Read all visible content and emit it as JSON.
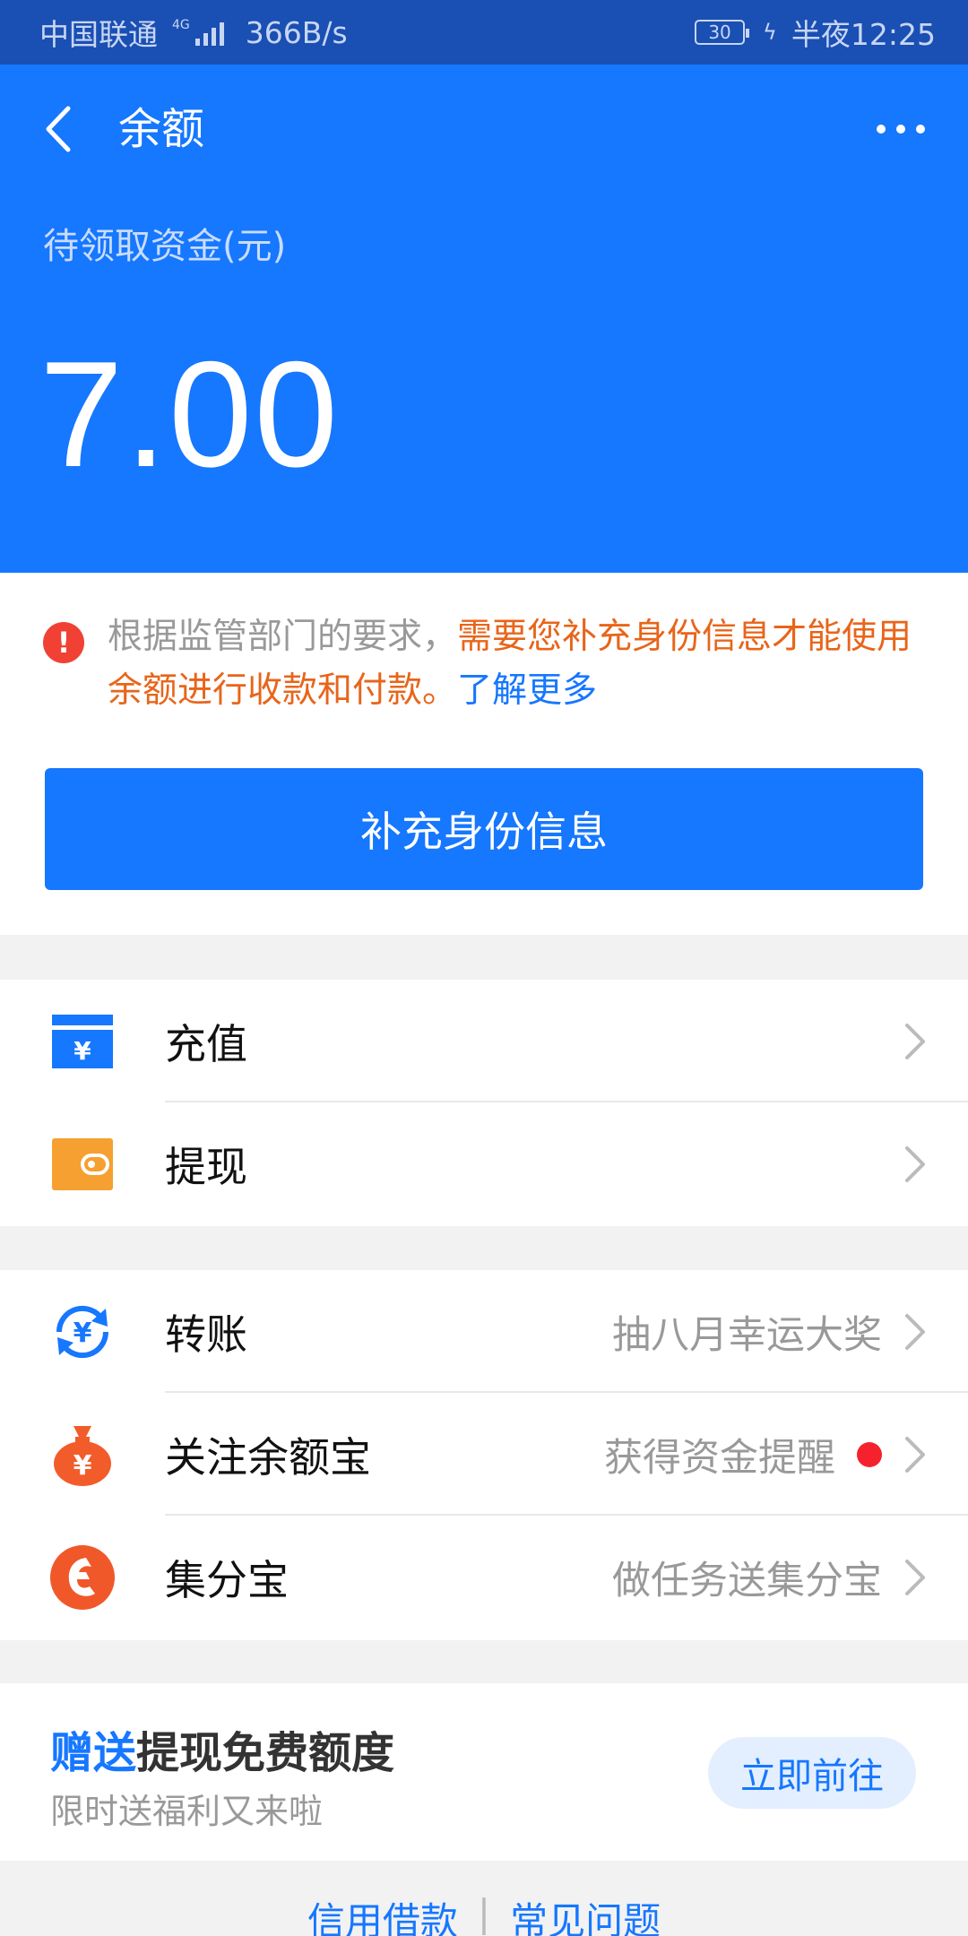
{
  "status_bar": {
    "carrier": "中国联通",
    "network": "4G",
    "speed": "366B/s",
    "battery": "30",
    "time": "半夜12:25"
  },
  "header": {
    "back_icon": "chevron-left-icon",
    "title": "余额",
    "more_icon": "more-dots-icon",
    "balance_label": "待领取资金(元)",
    "balance_amount": "7.00"
  },
  "notice": {
    "text_normal": "根据监管部门的要求，",
    "text_highlight": "需要您补充身份信息才能使用余额进行收款和付款。",
    "link": "了解更多",
    "button": "补充身份信息"
  },
  "group1": [
    {
      "icon": "recharge-icon",
      "label": "充值"
    },
    {
      "icon": "withdraw-wallet-icon",
      "label": "提现"
    }
  ],
  "group2": [
    {
      "icon": "transfer-icon",
      "label": "转账",
      "extra": "抽八月幸运大奖"
    },
    {
      "icon": "money-bag-icon",
      "label": "关注余额宝",
      "extra": "获得资金提醒"
    },
    {
      "icon": "jifenbao-icon",
      "label": "集分宝",
      "extra": "做任务送集分宝"
    }
  ],
  "promo": {
    "title_accent": "赠送",
    "title_rest": "提现免费额度",
    "subtitle": "限时送福利又来啦",
    "button": "立即前往"
  },
  "footer": {
    "link1": "信用借款",
    "separator": "|",
    "link2": "常见问题"
  },
  "colors": {
    "brand_blue": "#1677ff",
    "status_bar": "#1a4fb3",
    "warning_orange": "#e8651a",
    "alert_red": "#f04134"
  }
}
